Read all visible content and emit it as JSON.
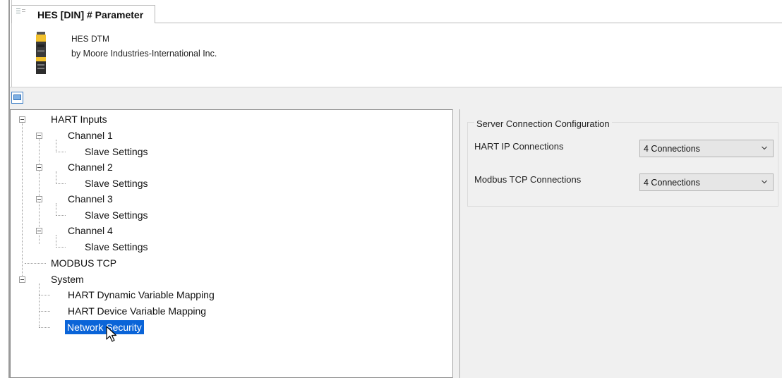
{
  "tab": {
    "title": "HES [DIN] # Parameter",
    "icon": "dtm-tab-icon"
  },
  "header": {
    "device_name": "HES DTM",
    "device_vendor": "by Moore Industries-International Inc.",
    "icon": "device-module-icon"
  },
  "toolbar": {
    "icon": "window-view-icon"
  },
  "tree": {
    "hart_inputs": "HART Inputs",
    "channel_1": "Channel 1",
    "channel_1_slave": "Slave Settings",
    "channel_2": "Channel 2",
    "channel_2_slave": "Slave Settings",
    "channel_3": "Channel 3",
    "channel_3_slave": "Slave Settings",
    "channel_4": "Channel 4",
    "channel_4_slave": "Slave Settings",
    "modbus_tcp": "MODBUS TCP",
    "system": "System",
    "hart_dynamic": "HART Dynamic Variable Mapping",
    "hart_device": "HART Device Variable Mapping",
    "network_security": "Network Security",
    "selected": "Network Security"
  },
  "panel": {
    "group_title": "Server Connection Configuration",
    "hart_ip_label": "HART IP Connections",
    "hart_ip_value": "4 Connections",
    "modbus_label": "Modbus TCP Connections",
    "modbus_value": "4 Connections"
  },
  "colors": {
    "selection": "#0a64d8",
    "pane_bg": "#f0f0f0",
    "accent": "#3f7fc6"
  }
}
